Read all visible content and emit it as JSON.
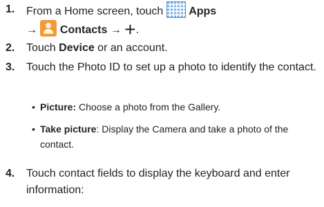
{
  "steps": [
    {
      "number": "1.",
      "line1_text": "From a Home screen, touch",
      "apps_label": "Apps",
      "arrow": "→",
      "contacts_label": "Contacts",
      "period": "."
    },
    {
      "number": "2.",
      "text_before": "Touch ",
      "bold": "Device",
      "text_after": " or an account."
    },
    {
      "number": "3.",
      "text": "Touch the Photo ID to set up a photo to identify the contact."
    },
    {
      "number": "4.",
      "text": "Touch contact fields to display the keyboard and enter information:"
    }
  ],
  "bullets": [
    {
      "bullet": "•",
      "term": "Picture:",
      "desc": " Choose a photo from the Gallery."
    },
    {
      "bullet": "•",
      "term": "Take picture",
      "desc": ": Display the Camera and take a photo of the contact."
    }
  ],
  "icons": {
    "apps": "apps-grid-icon",
    "contacts": "contacts-icon",
    "add": "plus-icon"
  },
  "colors": {
    "contacts_icon": "#f19a36",
    "apps_icon": "#6fa9e0"
  }
}
